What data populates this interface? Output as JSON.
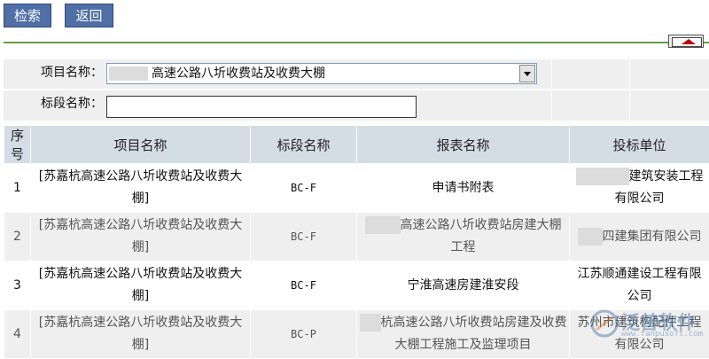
{
  "toolbar": {
    "search_label": "检索",
    "back_label": "返回"
  },
  "form": {
    "project_label": "项目名称：",
    "project_value": "高速公路八圻收费站及收费大棚",
    "section_label": "标段名称：",
    "section_value": ""
  },
  "table": {
    "headers": [
      "序号",
      "项目名称",
      "标段名称",
      "报表名称",
      "投标单位"
    ],
    "rows": [
      {
        "no": "1",
        "project": "[苏嘉杭高速公路八圻收费站及收费大棚]",
        "section": "BC-F",
        "report": "申请书附表",
        "bidder": "建筑安装工程有限公司"
      },
      {
        "no": "2",
        "project": "[苏嘉杭高速公路八圻收费站及收费大棚]",
        "section": "BC-F",
        "report": "高速公路八圻收费站房建大棚工程",
        "bidder": "四建集团有限公司"
      },
      {
        "no": "3",
        "project": "[苏嘉杭高速公路八圻收费站及收费大棚]",
        "section": "BC-F",
        "report": "宁淮高速房建淮安段",
        "bidder": "江苏顺通建设工程有限公司"
      },
      {
        "no": "4",
        "project": "[苏嘉杭高速公路八圻收费站及收费大棚]",
        "section": "BC-P",
        "report": "杭高速公路八圻收费站房建及收费大棚工程施工及监理项目",
        "bidder": "苏州市建筑构配件工程有限公司"
      }
    ]
  },
  "colors": {
    "accent_button": "#4f6fa6",
    "divider_green": "#5f9f3a",
    "header_bg": "#d4dce6"
  },
  "watermark": {
    "text": "泛普软件",
    "sub": "www.fanpusoft.com"
  }
}
